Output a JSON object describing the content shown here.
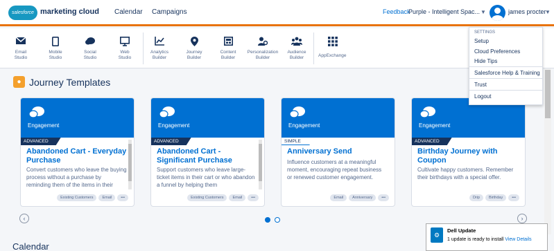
{
  "header": {
    "logo_text": "salesforce",
    "product": "marketing cloud",
    "nav": [
      "Calendar",
      "Campaigns"
    ],
    "feedback": "Feedback",
    "business_unit": "Purple - Intelligent Spac...",
    "user": "james procter",
    "accent": "#e8730c"
  },
  "apps": [
    {
      "label": "Email\nStudio",
      "icon": "envelope-icon"
    },
    {
      "label": "Mobile\nStudio",
      "icon": "phone-icon"
    },
    {
      "label": "Social\nStudio",
      "icon": "chat-icon"
    },
    {
      "label": "Web\nStudio",
      "icon": "monitor-icon"
    },
    {
      "label": "Analytics\nBuilder",
      "icon": "chart-icon"
    },
    {
      "label": "Journey\nBuilder",
      "icon": "map-pin-icon"
    },
    {
      "label": "Content\nBuilder",
      "icon": "content-icon"
    },
    {
      "label": "Personalization\nBuilder",
      "icon": "person-icon"
    },
    {
      "label": "Audience\nBuilder",
      "icon": "audience-icon"
    },
    {
      "label": "AppExchange",
      "icon": "grid-icon"
    }
  ],
  "section": {
    "title": "Journey Templates"
  },
  "cards": [
    {
      "category": "Engagement",
      "level": "ADVANCED",
      "title": "Abandoned Cart - Everyday Purchase",
      "desc": "Convert customers who leave the buying process without a purchase by reminding them of the items in their",
      "tags": [
        "Existing Customers",
        "Email",
        "•••"
      ]
    },
    {
      "category": "Engagement",
      "level": "ADVANCED",
      "title": "Abandoned Cart - Significant Purchase",
      "desc": "Support customers who leave large-ticket items in their cart or who abandon a funnel by helping them",
      "tags": [
        "Existing Customers",
        "Email",
        "•••"
      ]
    },
    {
      "category": "Engagement",
      "level": "SIMPLE",
      "title": "Anniversary Send",
      "desc": "Influence customers at a meaningful moment, encouraging repeat business or renewed customer engagement.",
      "tags": [
        "Email",
        "Anniversary",
        "•••"
      ]
    },
    {
      "category": "Engagement",
      "level": "ADVANCED",
      "title": "Birthday Journey with Coupon",
      "desc": "Cultivate happy customers. Remember their birthdays with a special offer.",
      "tags": [
        "Drip",
        "Birthday",
        "•••"
      ]
    }
  ],
  "next_section": "Calendar",
  "menu": {
    "heading": "SETTINGS",
    "items": [
      "Setup",
      "Cloud Preferences",
      "Hide Tips",
      "Salesforce Help & Training",
      "Trust",
      "Logout"
    ]
  },
  "toast": {
    "title": "Dell Update",
    "message": "1 update is ready to install",
    "link": "View Details"
  }
}
